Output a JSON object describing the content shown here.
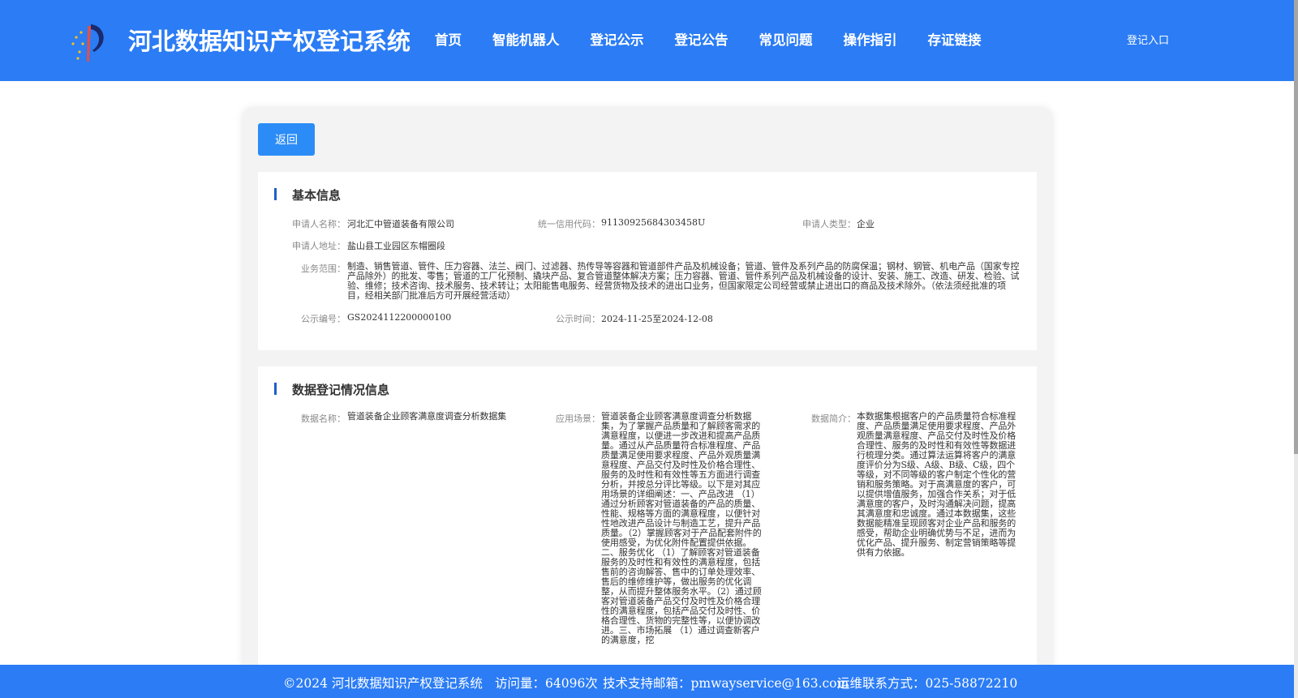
{
  "header": {
    "title": "河北数据知识产权登记系统",
    "login": "登记入口",
    "nav": [
      "首页",
      "智能机器人",
      "登记公示",
      "登记公告",
      "常见问题",
      "操作指引",
      "存证链接"
    ]
  },
  "colors": {
    "primary": "#2b7cf5",
    "button": "#2b8cf7",
    "accent": "#1f5fc7"
  },
  "back_button": "返回",
  "basic": {
    "title": "基本信息",
    "applicant_name_label": "申请人名称：",
    "applicant_name": "河北汇中管道装备有限公司",
    "credit_code_label": "统一信用代码：",
    "credit_code": "91130925684303458U",
    "applicant_type_label": "申请人类型：",
    "applicant_type": "企业",
    "address_label": "申请人地址：",
    "address": "盐山县工业园区东帽圈段",
    "scope_label": "业务范围：",
    "scope": "制造、销售管道、管件、压力容器、法兰、阀门、过滤器、热传导等容器和管道部件产品及机械设备；管道、管件及系列产品的防腐保温；钢材、钢管、机电产品（国家专控产品除外）的批发、零售；管道的工厂化预制、撬块产品、复合管道整体解决方案；压力容器、管道、管件系列产品及机械设备的设计、安装、施工、改造、研发、检验、试验、维修；技术咨询、技术服务、技术转让；太阳能售电服务、经营货物及技术的进出口业务，但国家限定公司经营或禁止进出口的商品及技术除外。（依法须经批准的项目，经相关部门批准后方可开展经营活动）",
    "pub_no_label": "公示编号：",
    "pub_no": "GS2024112200000100",
    "pub_time_label": "公示时间：",
    "pub_time": "2024-11-25至2024-12-08"
  },
  "data_reg": {
    "title": "数据登记情况信息",
    "name_label": "数据名称：",
    "name": "管道装备企业顾客满意度调查分析数据集",
    "scene_label": "应用场景：",
    "scene": "管道装备企业顾客满意度调查分析数据集，为了掌握产品质量和了解顾客需求的满意程度，以便进一步改进和提高产品质量。通过从产品质量符合标准程度、产品质量满足使用要求程度、产品外观质量满意程度、产品交付及时性及价格合理性、服务的及时性和有效性等五方面进行调查分析，并按总分评比等级。以下是对其应用场景的详细阐述：一、产品改进 （1）通过分析顾客对管道装备的产品的质量、性能、规格等方面的满意程度，以便针对性地改进产品设计与制造工艺，提升产品质量。（2）掌握顾客对于产品配套附件的使用感受，为优化附件配置提供依据。二、服务优化 （1）了解顾客对管道装备服务的及时性和有效性的满意程度，包括售前的咨询解答、售中的订单处理效率、售后的维修维护等，做出服务的优化调整，从而提升整体服务水平。（2）通过顾客对管道装备产品交付及时性及价格合理性的满意程度，包括产品交付及时性、价格合理性、货物的完整性等，以便协调改进。三、市场拓展 （1）通过调查新客户的满意度，挖",
    "intro_label": "数据简介：",
    "intro": "本数据集根据客户的产品质量符合标准程度、产品质量满足使用要求程度、产品外观质量满意程度、产品交付及时性及价格合理性、服务的及时性和有效性等数据进行梳理分类。通过算法运算将客户的满意度评价分为S级、A级、B级、C级，四个等级，对不同等级的客户制定个性化的营销和服务策略。对于高满意度的客户，可以提供增值服务，加强合作关系；对于低满意度的客户，及时沟通解决问题，提高其满意度和忠诚度。通过本数据集，这些数据能精准呈现顾客对企业产品和服务的感受，帮助企业明确优势与不足，进而为优化产品、提升服务、制定营销策略等提供有力依据。"
  },
  "footer": {
    "copyright": "©2024 河北数据知识产权登记系统",
    "visits": "访问量：64096次",
    "email": "技术支持邮箱：pmwayservice@163.com",
    "phone": "运维联系方式：025-58872210"
  }
}
